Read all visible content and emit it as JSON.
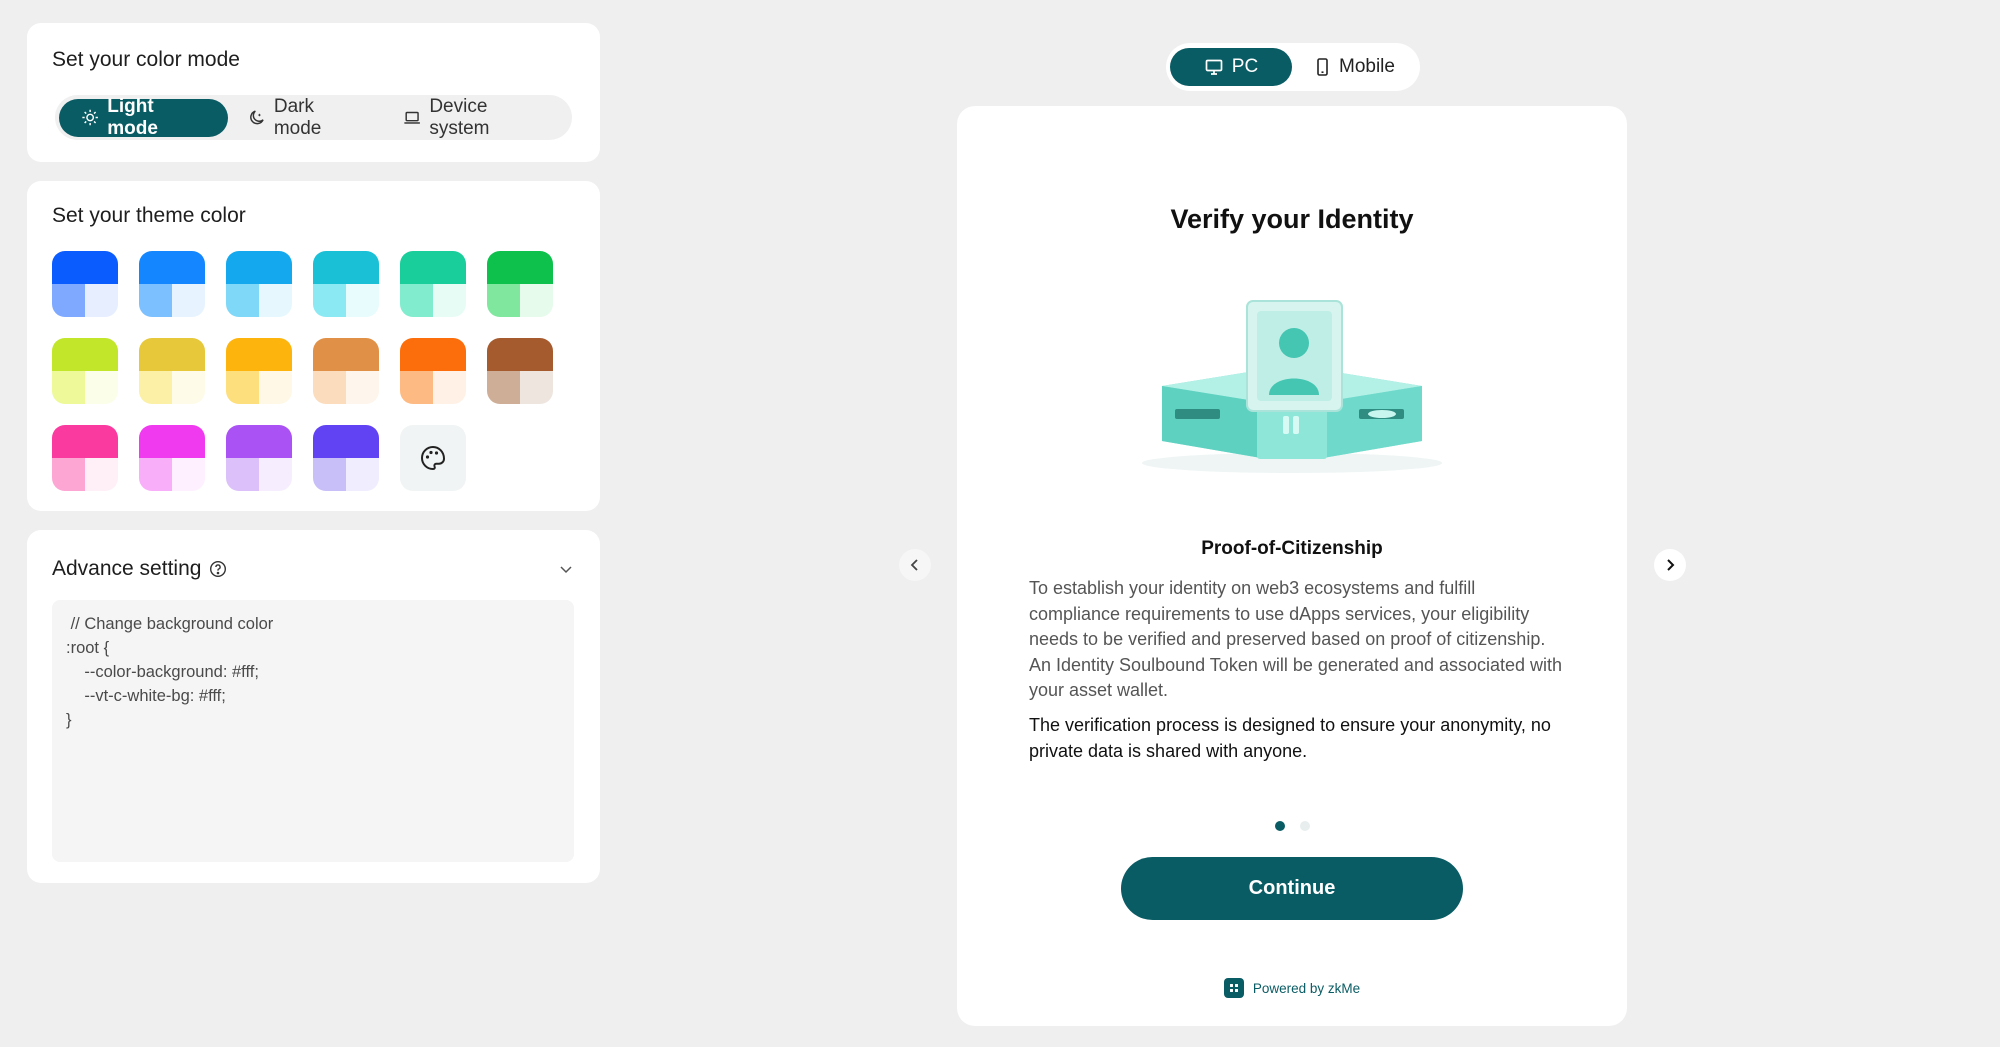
{
  "color_mode": {
    "title": "Set your color mode",
    "options": [
      {
        "label": "Light mode",
        "icon": "sun-icon",
        "active": true
      },
      {
        "label": "Dark mode",
        "icon": "moon-icon",
        "active": false
      },
      {
        "label": "Device system",
        "icon": "laptop-icon",
        "active": false
      }
    ]
  },
  "theme": {
    "title": "Set your theme color",
    "swatches": [
      {
        "top": "#0b5cff",
        "bl": "#7fa9ff",
        "br": "#e6eeff"
      },
      {
        "top": "#1486ff",
        "bl": "#7dc0ff",
        "br": "#e7f3ff"
      },
      {
        "top": "#14a9ee",
        "bl": "#7fd8f8",
        "br": "#e6f8fe"
      },
      {
        "top": "#19c0d6",
        "bl": "#8ae9f3",
        "br": "#e8fbfd"
      },
      {
        "top": "#19ce9a",
        "bl": "#82ecce",
        "br": "#e8fcf6"
      },
      {
        "top": "#0dc14c",
        "bl": "#7fe79e",
        "br": "#e6fbec"
      },
      {
        "top": "#c2e62a",
        "bl": "#eefa9a",
        "br": "#fbfee8"
      },
      {
        "top": "#e6c83a",
        "bl": "#fbf0a6",
        "br": "#fefbe8"
      },
      {
        "top": "#fdb40d",
        "bl": "#fedf7e",
        "br": "#fff8e6"
      },
      {
        "top": "#e09147",
        "bl": "#fbdcbc",
        "br": "#fef5ec"
      },
      {
        "top": "#fb6e0b",
        "bl": "#fdbb83",
        "br": "#fff1e6"
      },
      {
        "top": "#a65b2f",
        "bl": "#cfae98",
        "br": "#eee5df"
      },
      {
        "top": "#fb3a9f",
        "bl": "#fda5d3",
        "br": "#fff0f7"
      },
      {
        "top": "#f03af0",
        "bl": "#f9aef9",
        "br": "#fef0fe"
      },
      {
        "top": "#ab52f4",
        "bl": "#dcc0f9",
        "br": "#f6eefe"
      },
      {
        "top": "#6243f3",
        "bl": "#c8bff9",
        "br": "#f0edfe"
      }
    ],
    "custom_icon": "palette-icon"
  },
  "advance": {
    "title": "Advance setting",
    "code": " // Change background color\n:root {\n    --color-background: #fff;\n    --vt-c-white-bg: #fff;\n}"
  },
  "device": {
    "options": [
      {
        "label": "PC",
        "icon": "monitor-icon",
        "active": true
      },
      {
        "label": "Mobile",
        "icon": "phone-icon",
        "active": false
      }
    ]
  },
  "preview": {
    "title": "Verify your Identity",
    "subtitle": "Proof-of-Citizenship",
    "body": "To establish your identity on web3 ecosystems and fulfill compliance requirements to use dApps services, your eligibility needs to be verified and preserved based on proof of citizenship. An Identity Soulbound Token will be generated and associated with your asset wallet.",
    "body2": "The verification process is designed to ensure your anonymity, no private data is shared with anyone.",
    "continue_label": "Continue",
    "powered_by": "Powered by zkMe",
    "pages": 2,
    "current_page": 1
  },
  "colors": {
    "accent": "#0a5c64",
    "background": "#efefef"
  }
}
